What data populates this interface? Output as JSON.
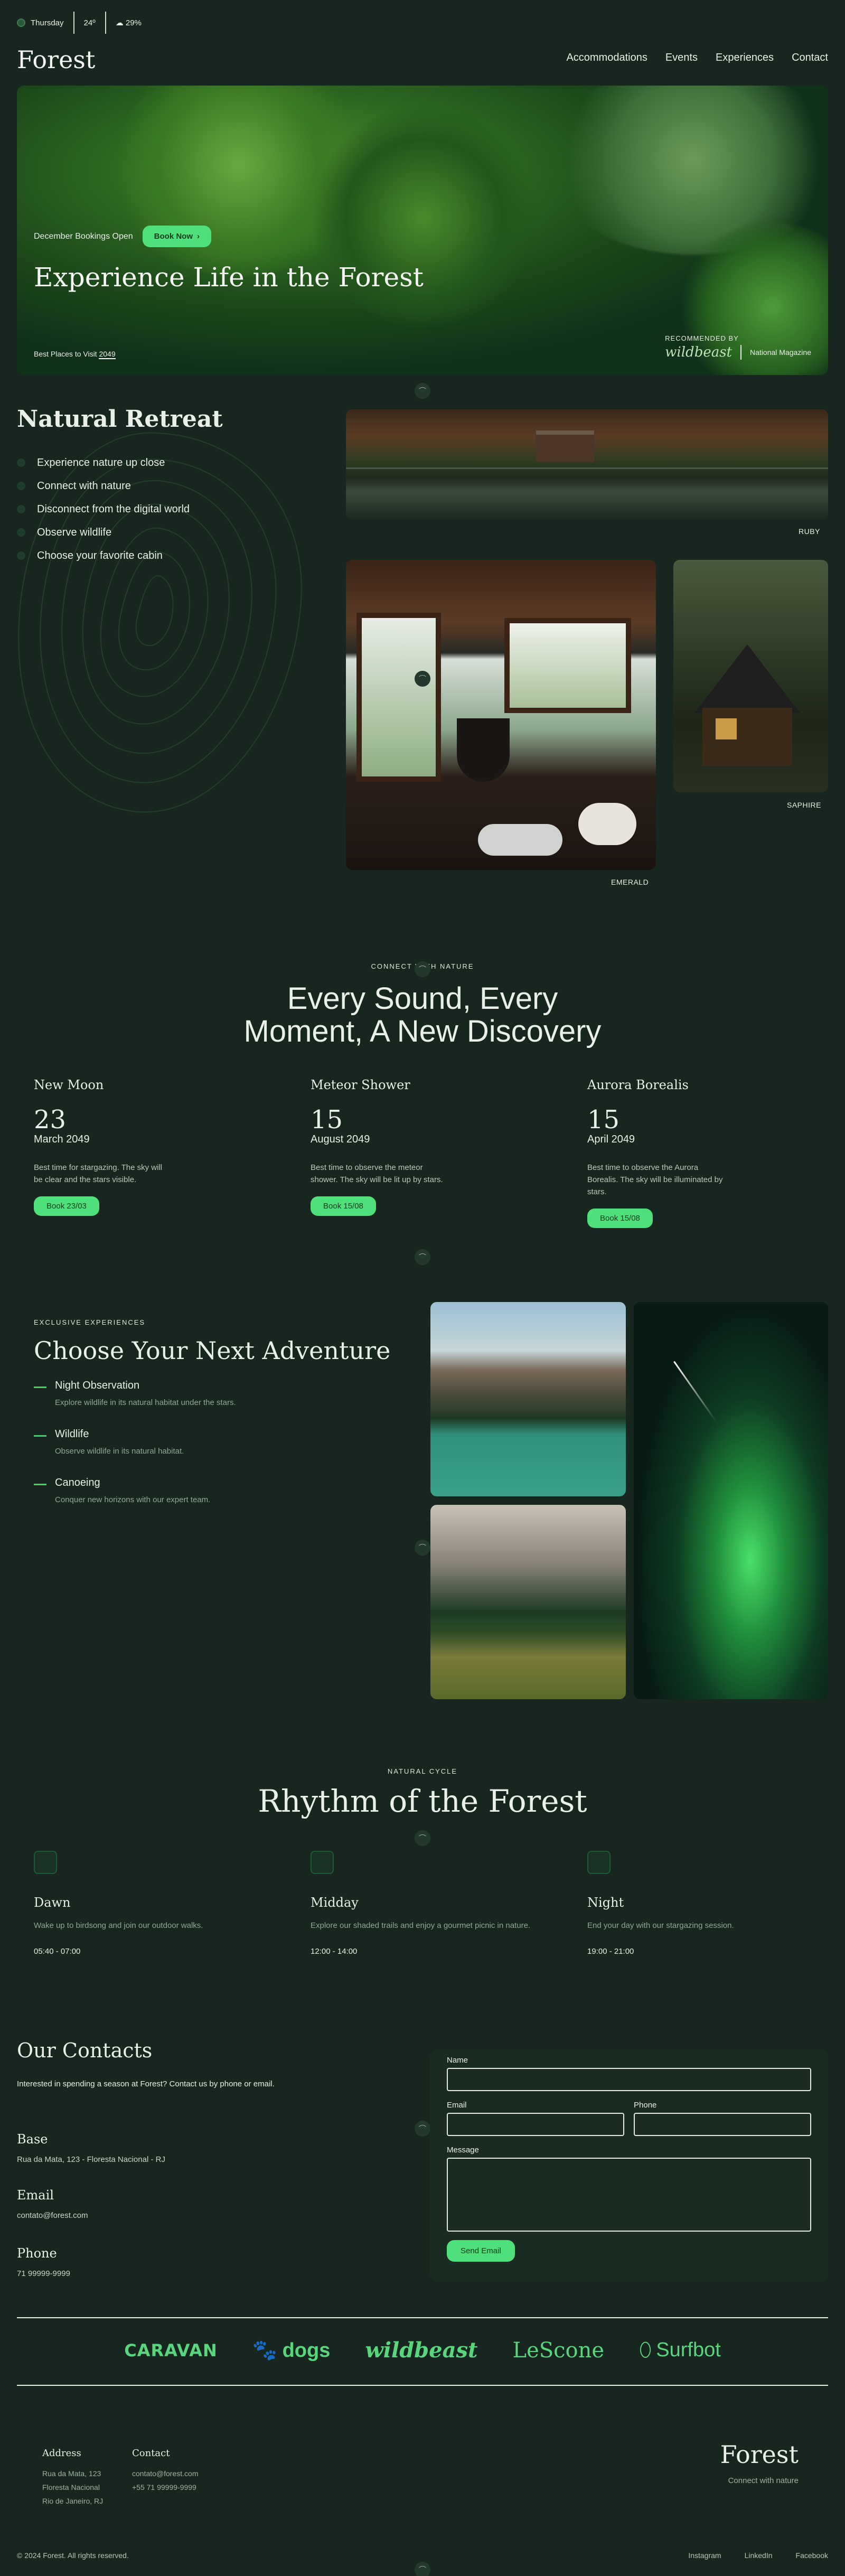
{
  "topbar": {
    "day": "Thursday",
    "temp": "24º",
    "rain": "29%"
  },
  "header": {
    "logo": "Forest",
    "nav": [
      "Accommodations",
      "Events",
      "Experiences",
      "Contact"
    ]
  },
  "hero": {
    "bookings_text": "December Bookings Open",
    "book_button": "Book Now",
    "title": "Experience Life in the Forest",
    "best_prefix": "Best Places to Visit",
    "best_year": "2049",
    "recommended_by": "RECOMMENDED BY",
    "brand1": "wildbeast",
    "brand2": "National Magazine"
  },
  "retreat": {
    "title": "Natural Retreat",
    "items": [
      "Experience nature up close",
      "Connect with nature",
      "Disconnect from the digital world",
      "Observe wildlife",
      "Choose your favorite cabin"
    ],
    "cabins": [
      "RUBY",
      "EMERALD",
      "SAPHIRE"
    ]
  },
  "sound": {
    "eyebrow": "CONNECT WITH NATURE",
    "title_line1": "Every Sound, Every",
    "title_line2": "Moment, A New Discovery",
    "events": [
      {
        "name": "New Moon",
        "day": "23",
        "date": "March 2049",
        "desc": "Best time for stargazing. The sky will be clear and the stars visible.",
        "button": "Book 23/03"
      },
      {
        "name": "Meteor Shower",
        "day": "15",
        "date": "August 2049",
        "desc": "Best time to observe the meteor shower. The sky will be lit up by stars.",
        "button": "Book 15/08"
      },
      {
        "name": "Aurora Borealis",
        "day": "15",
        "date": "April 2049",
        "desc": "Best time to observe the Aurora Borealis. The sky will be illuminated by stars.",
        "button": "Book 15/08"
      }
    ]
  },
  "adventure": {
    "eyebrow": "EXCLUSIVE EXPERIENCES",
    "title": "Choose Your Next Adventure",
    "items": [
      {
        "title": "Night Observation",
        "desc": "Explore wildlife in its natural habitat under the stars."
      },
      {
        "title": "Wildlife",
        "desc": "Observe wildlife in its natural habitat."
      },
      {
        "title": "Canoeing",
        "desc": "Conquer new horizons with our expert team."
      }
    ]
  },
  "rhythm": {
    "eyebrow": "NATURAL CYCLE",
    "title": "Rhythm of the Forest",
    "cols": [
      {
        "title": "Dawn",
        "desc": "Wake up to birdsong and join our outdoor walks.",
        "time": "05:40 - 07:00"
      },
      {
        "title": "Midday",
        "desc": "Explore our shaded trails and enjoy a gourmet picnic in nature.",
        "time": "12:00 - 14:00"
      },
      {
        "title": "Night",
        "desc": "End your day with our stargazing session.",
        "time": "19:00 - 21:00"
      }
    ]
  },
  "contacts": {
    "title": "Our Contacts",
    "intro": "Interested in spending a season at Forest? Contact us by phone or email.",
    "base_label": "Base",
    "base_value": "Rua da Mata, 123 - Floresta Nacional - RJ",
    "email_label": "Email",
    "email_value": "contato@forest.com",
    "phone_label": "Phone",
    "phone_value": "71 99999-9999",
    "form": {
      "name": "Name",
      "email": "Email",
      "phone": "Phone",
      "message": "Message",
      "send": "Send Email"
    }
  },
  "brands": [
    "CARAVAN",
    "dogs",
    "wildbeast",
    "LeScone",
    "Surfbot"
  ],
  "footer": {
    "address_title": "Address",
    "address_lines": [
      "Rua da Mata, 123",
      "Floresta Nacional",
      "Rio de Janeiro, RJ"
    ],
    "contact_title": "Contact",
    "contact_lines": [
      "contato@forest.com",
      "+55 71 99999-9999"
    ],
    "logo": "Forest",
    "tagline": "Connect with nature",
    "copyright": "© 2024 Forest. All rights reserved.",
    "social": [
      "Instagram",
      "LinkedIn",
      "Facebook"
    ]
  }
}
